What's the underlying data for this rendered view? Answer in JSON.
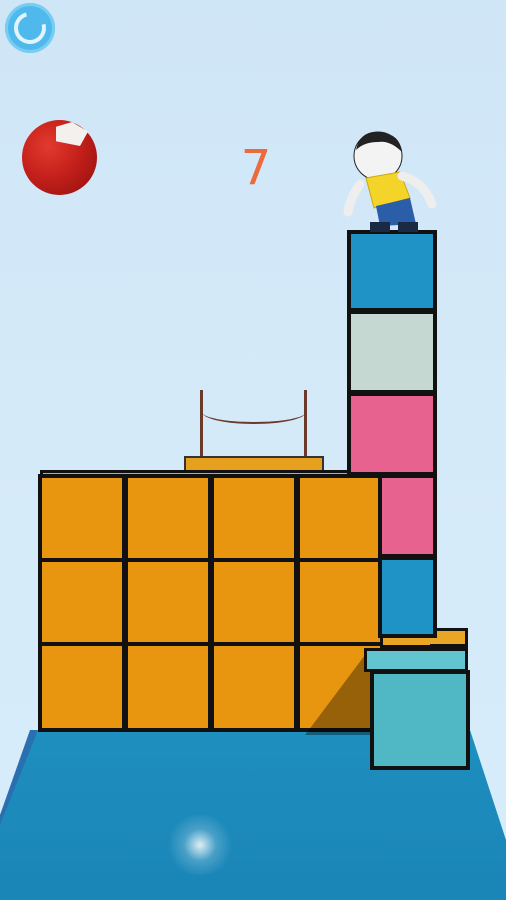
{
  "hud": {
    "score": "7",
    "pause_icon": "circular-arrow-icon"
  },
  "scene": {
    "ball_icon": "red-ball-icon",
    "player": "stick-figure-character",
    "colors": {
      "sky": "#cfe6f7",
      "floor": "#1e8fbf",
      "wall_cube": "#e8960f",
      "score_text": "#ec6b3d",
      "tower_top_cube": "#1f93c6",
      "tower_gray_cube": "#c5d8d2",
      "tower_pink_cube": "#e8628f",
      "teal_cube": "#4fb8c4"
    },
    "tower_stack_colors": [
      "blue",
      "gray",
      "pink",
      "pink",
      "blue"
    ],
    "wall_grid": {
      "rows": 3,
      "columns": 4
    }
  }
}
